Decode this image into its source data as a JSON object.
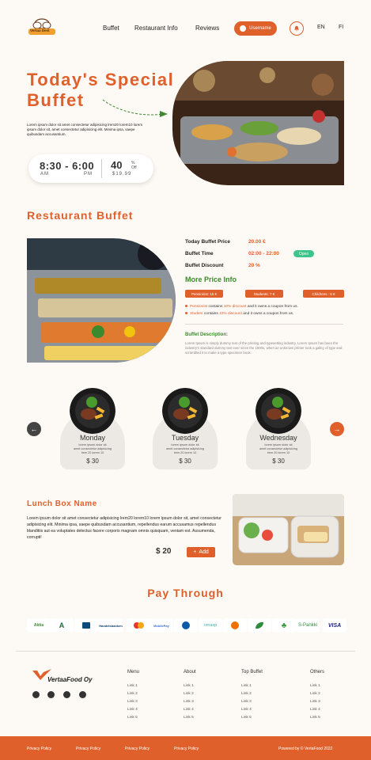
{
  "header": {
    "logo_text": "Vertaa Dest",
    "nav": [
      "Buffet",
      "Restaurant Info",
      "Reviews"
    ],
    "user_label": "Username",
    "lang": [
      "EN",
      "FI"
    ]
  },
  "hero": {
    "title": "Today's Special Buffet",
    "desc": "Lorem ipsum dolor sit amet consectetur adipisicing lrem20 lorem10 lorem ipsum dolor sit, amet consectetur adipisicing elit. Minima ipsa, saepe quibusdam accusantium.",
    "time": "8:30 - 6:00",
    "am": "AM",
    "pm": "PM",
    "discount": "40",
    "pct": "%",
    "off": "Off",
    "price": "$19.99"
  },
  "buffet": {
    "title": "Restaurant Buffet",
    "rows": [
      {
        "label": "Today Buffet Price",
        "value": "20.00 €"
      },
      {
        "label": "Buffet Time",
        "value": "02:00 - 22:00"
      },
      {
        "label": "Buffet Discount",
        "value": "20 %"
      }
    ],
    "open_label": "Open",
    "more_title": "More Price Info",
    "pills": [
      "Pensionist: 15 €",
      "Students: 7 €",
      "Childrens : 5 €"
    ],
    "notes": [
      {
        "who": "Pensionist",
        "pre": " contains ",
        "hl": "10% discount",
        "post": " and it owns a coupon from us."
      },
      {
        "who": "Student",
        "pre": " contains ",
        "hl": "10% discount",
        "post": " and it owns a coupon from us."
      }
    ],
    "desc_title": "Buffet Description:",
    "desc": "Lorem Ipsum is simply dummy text of the printing and typesetting industry. Lorem Ipsum has been the industry's standard dummy text ever since the 1500s, when an unknown printer took a galley of type and scrambled it to make a type specimen book."
  },
  "days": [
    {
      "name": "Monday",
      "l1": "lorem ipsum dolor sit",
      "l2": "amet consectetur adipisicing",
      "l3": "lrem 20 lorem 10",
      "price": "$ 30"
    },
    {
      "name": "Tuesday",
      "l1": "lorem ipsum dolor sit",
      "l2": "amet consectetur adipisicing",
      "l3": "lrem 20 lorem 10",
      "price": "$ 30"
    },
    {
      "name": "Wednesday",
      "l1": "lorem ipsum dolor sit",
      "l2": "amet consectetur adipisicing",
      "l3": "lrem 20 lorem 10",
      "price": "$ 30"
    }
  ],
  "lunchbox": {
    "title": "Lunch Box Name",
    "desc": "Lorem ipsum dolor sit amet consectetur adipisicing lrem20 lorem10 lorem ipsum dolor sit, amet consectetur adipisicing elit. Minima ipsa, saepe quibusdam accusantium, repellendus earum accusamus repellendus blanditiis aut ea voluptates delectus facere corporis magnam omnis quisquam, veniam est. Assumenda, corrupti!",
    "price": "$ 20",
    "add_label": "Add"
  },
  "pay": {
    "title": "Pay Through",
    "banks": [
      "Aktia",
      "A",
      "",
      "Handelsbanken",
      "",
      "MobilePay",
      "",
      "omasp",
      "",
      "",
      "",
      "S-Pankki",
      "VISA"
    ]
  },
  "footer": {
    "logo_text": "VertaaFood Oy",
    "cols": [
      {
        "title": "Menu",
        "links": [
          "Link 1",
          "Link 2",
          "Link 3",
          "Link 4",
          "Link 5"
        ]
      },
      {
        "title": "About",
        "links": [
          "Link 1",
          "Link 2",
          "Link 3",
          "Link 4",
          "Link 5"
        ]
      },
      {
        "title": "Top Buffet",
        "links": [
          "Link 1",
          "Link 2",
          "Link 3",
          "Link 4",
          "Link 5"
        ]
      },
      {
        "title": "Others",
        "links": [
          "Link 1",
          "Link 2",
          "Link 3",
          "Link 4",
          "Link 5"
        ]
      }
    ],
    "bottom_links": [
      "Privacy Policy",
      "Privacy Policy",
      "Privacy Policy",
      "Privacy Policy"
    ],
    "powered": "Powered by © VertaFood 2022"
  },
  "colors": {
    "accent": "#e0602c",
    "green": "#3b8a2e",
    "open": "#3cc48a"
  }
}
